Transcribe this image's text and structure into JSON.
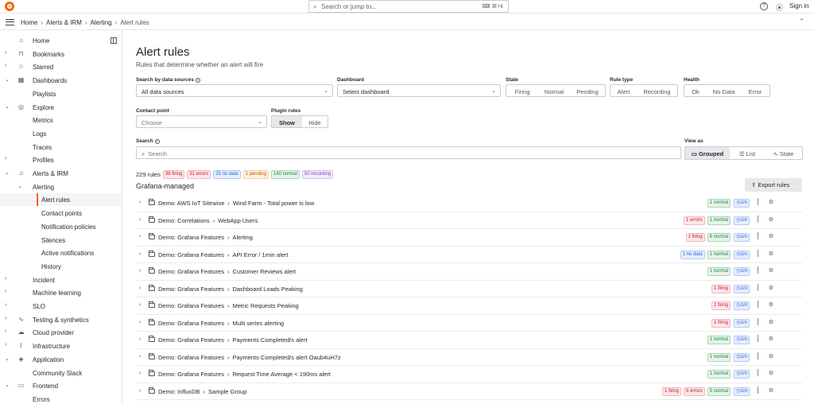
{
  "topbar": {
    "search_placeholder": "Search or jump to...",
    "shortcut": "⌨ ⌘+k",
    "sign_in": "Sign in"
  },
  "breadcrumb": [
    "Home",
    "Alerts & IRM",
    "Alerting",
    "Alert rules"
  ],
  "sidebar": {
    "items": [
      {
        "label": "Home",
        "icon": "home-icon",
        "chev": ""
      },
      {
        "label": "Bookmarks",
        "icon": "bookmark-icon",
        "chev": "›"
      },
      {
        "label": "Starred",
        "icon": "star-icon",
        "chev": "›"
      },
      {
        "label": "Dashboards",
        "icon": "apps-icon",
        "chev": "⌄"
      },
      {
        "label": "Playlists",
        "icon": "",
        "chev": ""
      },
      {
        "label": "Explore",
        "icon": "compass-icon",
        "chev": "⌄"
      },
      {
        "label": "Metrics",
        "icon": "",
        "chev": ""
      },
      {
        "label": "Logs",
        "icon": "",
        "chev": ""
      },
      {
        "label": "Traces",
        "icon": "",
        "chev": ""
      },
      {
        "label": "Profiles",
        "icon": "",
        "chev": "›"
      },
      {
        "label": "Alerts & IRM",
        "icon": "bell-icon",
        "chev": "⌄"
      },
      {
        "label": "Alerting",
        "icon": "",
        "chev": "⌄"
      },
      {
        "label": "Alert rules",
        "icon": "",
        "chev": ""
      },
      {
        "label": "Contact points",
        "icon": "",
        "chev": ""
      },
      {
        "label": "Notification policies",
        "icon": "",
        "chev": ""
      },
      {
        "label": "Silences",
        "icon": "",
        "chev": ""
      },
      {
        "label": "Active notifications",
        "icon": "",
        "chev": ""
      },
      {
        "label": "History",
        "icon": "",
        "chev": ""
      },
      {
        "label": "Incident",
        "icon": "",
        "chev": "›"
      },
      {
        "label": "Machine learning",
        "icon": "",
        "chev": "›"
      },
      {
        "label": "SLO",
        "icon": "",
        "chev": "›"
      },
      {
        "label": "Testing & synthetics",
        "icon": "heart-rate-icon",
        "chev": "›"
      },
      {
        "label": "Cloud provider",
        "icon": "cloud-icon",
        "chev": "›"
      },
      {
        "label": "Infrastructure",
        "icon": "pulse-icon",
        "chev": "›"
      },
      {
        "label": "Application",
        "icon": "layer-icon",
        "chev": "⌄"
      },
      {
        "label": "Community Slack",
        "icon": "",
        "chev": ""
      },
      {
        "label": "Frontend",
        "icon": "browser-icon",
        "chev": "⌄"
      },
      {
        "label": "Errors",
        "icon": "",
        "chev": ""
      }
    ]
  },
  "main": {
    "title": "Alert rules",
    "subtitle": "Rules that determine whether an alert will fire",
    "filters": {
      "datasources_label": "Search by data sources",
      "datasources_value": "All data sources",
      "dashboard_label": "Dashboard",
      "dashboard_placeholder": "Select dashboard",
      "state_label": "State",
      "state_options": [
        "Firing",
        "Normal",
        "Pending"
      ],
      "ruletype_label": "Rule type",
      "ruletype_options": [
        "Alert",
        "Recording"
      ],
      "health_label": "Health",
      "health_options": [
        "Ok",
        "No Data",
        "Error"
      ],
      "contact_label": "Contact point",
      "contact_placeholder": "Choose",
      "plugin_label": "Plugin rules",
      "plugin_options": [
        "Show",
        "Hide"
      ],
      "search_label": "Search",
      "search_placeholder": "Search",
      "viewas_label": "View as",
      "viewas_options": [
        "Grouped",
        "List",
        "State"
      ]
    },
    "summary": {
      "count": "229 rules",
      "firing": "38 firing",
      "errors": "31 errors",
      "nodata": "25 no data",
      "pending": "1 pending",
      "normal": "140 normal",
      "recording": "50 recording"
    },
    "section_title": "Grafana-managed",
    "export_label": "Export rules",
    "groups": [
      {
        "folder": "Demo: AWS IoT Sitewise",
        "group": "Wind Farm - Total power is low",
        "badges": [
          {
            "t": "1 normal",
            "c": "b-green"
          }
        ],
        "dur": "1m"
      },
      {
        "folder": "Demo: Correlations",
        "group": "WebApp Users",
        "badges": [
          {
            "t": "1 errors",
            "c": "b-red"
          },
          {
            "t": "1 normal",
            "c": "b-green"
          }
        ],
        "dur": "1m"
      },
      {
        "folder": "Demo: Grafana Features",
        "group": "Alerting",
        "badges": [
          {
            "t": "1 firing",
            "c": "b-red"
          },
          {
            "t": "6 normal",
            "c": "b-green"
          }
        ],
        "dur": "1m"
      },
      {
        "folder": "Demo: Grafana Features",
        "group": "API Error / 1min alert",
        "badges": [
          {
            "t": "1 no data",
            "c": "b-blue"
          },
          {
            "t": "1 normal",
            "c": "b-green"
          }
        ],
        "dur": "1m"
      },
      {
        "folder": "Demo: Grafana Features",
        "group": "Customer Reviews alert",
        "badges": [
          {
            "t": "1 normal",
            "c": "b-green"
          }
        ],
        "dur": "1m"
      },
      {
        "folder": "Demo: Grafana Features",
        "group": "Dashboard Loads Peaking",
        "badges": [
          {
            "t": "1 firing",
            "c": "b-red"
          }
        ],
        "dur": "1m"
      },
      {
        "folder": "Demo: Grafana Features",
        "group": "Metric Requests Peaking",
        "badges": [
          {
            "t": "1 firing",
            "c": "b-red"
          }
        ],
        "dur": "1m"
      },
      {
        "folder": "Demo: Grafana Features",
        "group": "Multi series alerting",
        "badges": [
          {
            "t": "1 firing",
            "c": "b-red"
          }
        ],
        "dur": "1m"
      },
      {
        "folder": "Demo: Grafana Features",
        "group": "Payments Completed/s alert",
        "badges": [
          {
            "t": "1 normal",
            "c": "b-green"
          }
        ],
        "dur": "1m"
      },
      {
        "folder": "Demo: Grafana Features",
        "group": "Payments Completed/s alert Oaub4uH7z",
        "badges": [
          {
            "t": "1 normal",
            "c": "b-green"
          }
        ],
        "dur": "1m"
      },
      {
        "folder": "Demo: Grafana Features",
        "group": "Request Time Average < 190ms alert",
        "badges": [
          {
            "t": "1 normal",
            "c": "b-green"
          }
        ],
        "dur": "1m"
      },
      {
        "folder": "Demo: InfluxDB",
        "group": "Sample Group",
        "badges": [
          {
            "t": "1 firing",
            "c": "b-red"
          },
          {
            "t": "6 errors",
            "c": "b-red"
          },
          {
            "t": "5 normal",
            "c": "b-green"
          }
        ],
        "dur": "1m"
      }
    ]
  }
}
